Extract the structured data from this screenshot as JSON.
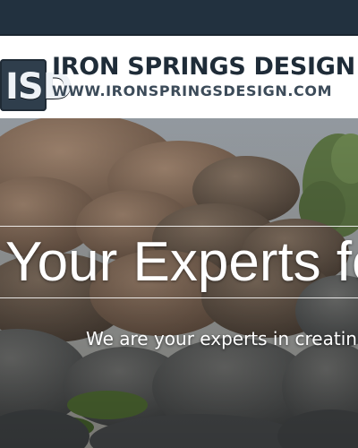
{
  "logo": {
    "mark_text": "ISD",
    "company_name": "IRON SPRINGS DESIGN",
    "url_text": "WWW.IRONSPRINGSDESIGN.COM"
  },
  "hero": {
    "headline": "Your Experts fo",
    "subheadline": "We are your experts in creatin"
  }
}
